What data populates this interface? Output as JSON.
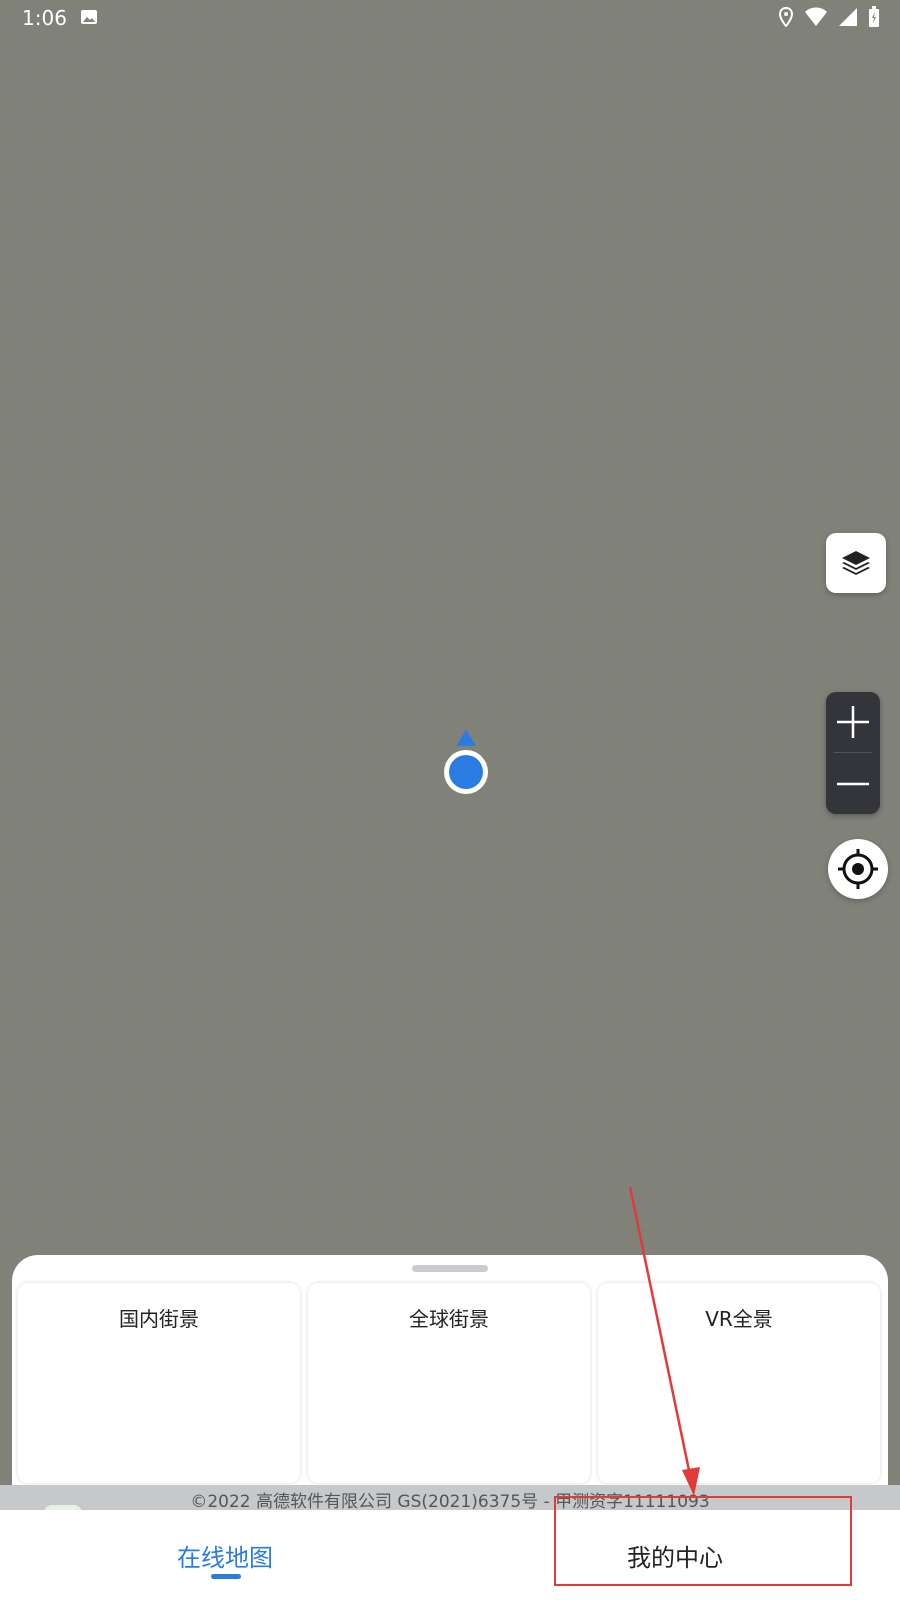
{
  "status_bar": {
    "time": "1:06",
    "icons": [
      "image-icon",
      "location-icon",
      "wifi-icon",
      "signal-icon",
      "battery-icon"
    ]
  },
  "map_controls": {
    "layers_icon": "layers-icon",
    "zoom_in_icon": "plus-icon",
    "zoom_out_icon": "minus-icon",
    "locate_icon": "crosshair-icon"
  },
  "sheet": {
    "cards": [
      {
        "label": "国内街景"
      },
      {
        "label": "全球街景"
      },
      {
        "label": "VR全景"
      }
    ]
  },
  "copyright": "©2022 高德软件有限公司 GS(2021)6375号 - 甲测资字11111093",
  "bottom_nav": {
    "tabs": [
      {
        "label": "在线地图",
        "active": true
      },
      {
        "label": "我的中心",
        "active": false
      }
    ]
  },
  "colors": {
    "accent": "#2a7be4",
    "map_bg": "#80827a",
    "annotation": "#e03a3a"
  }
}
